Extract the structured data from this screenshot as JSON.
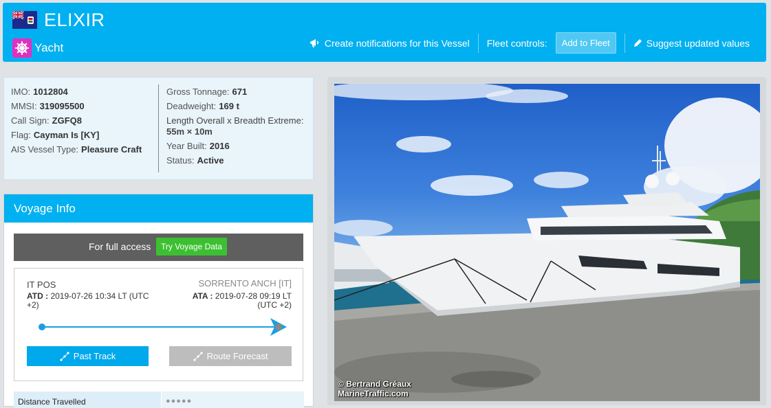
{
  "header": {
    "vessel_name": "ELIXIR",
    "vessel_type": "Yacht",
    "flag_icon": "cayman-islands-flag-icon",
    "type_icon": "yacht-wheel-icon",
    "notify_label": "Create notifications for this Vessel",
    "fleet_controls_label": "Fleet controls:",
    "add_fleet_label": "Add to Fleet",
    "suggest_label": "Suggest updated values"
  },
  "info": {
    "left": [
      {
        "label": "IMO:",
        "value": "1012804"
      },
      {
        "label": "MMSI:",
        "value": "319095500"
      },
      {
        "label": "Call Sign:",
        "value": "ZGFQ8"
      },
      {
        "label": "Flag:",
        "value": "Cayman Is [KY]"
      },
      {
        "label": "AIS Vessel Type:",
        "value": "Pleasure Craft"
      }
    ],
    "right": [
      {
        "label": "Gross Tonnage:",
        "value": "671"
      },
      {
        "label": "Deadweight:",
        "value": "169 t"
      },
      {
        "label": "Length Overall x Breadth Extreme:",
        "value": "55m × 10m"
      },
      {
        "label": "Year Built:",
        "value": "2016"
      },
      {
        "label": "Status:",
        "value": "Active"
      }
    ]
  },
  "voyage": {
    "title": "Voyage Info",
    "access_text": "For full access",
    "try_label": "Try Voyage Data",
    "departure_port": "IT POS",
    "arrival_port": "SORRENTO ANCH [IT]",
    "atd_label": "ATD :",
    "atd_value": "2019-07-26 10:34 LT (UTC +2)",
    "ata_label": "ATA :",
    "ata_value": "2019-07-28 09:19 LT (UTC +2)",
    "past_track_label": "Past Track",
    "route_forecast_label": "Route Forecast",
    "distance_label": "Distance Travelled",
    "distance_value": "●●●●●"
  },
  "photo": {
    "credit_author": "© Bertrand Gréaux",
    "credit_site": "MarineTraffic.com"
  },
  "colors": {
    "accent": "#00b0f0",
    "green": "#3cc032",
    "type_icon_bg": "#e030c0"
  }
}
